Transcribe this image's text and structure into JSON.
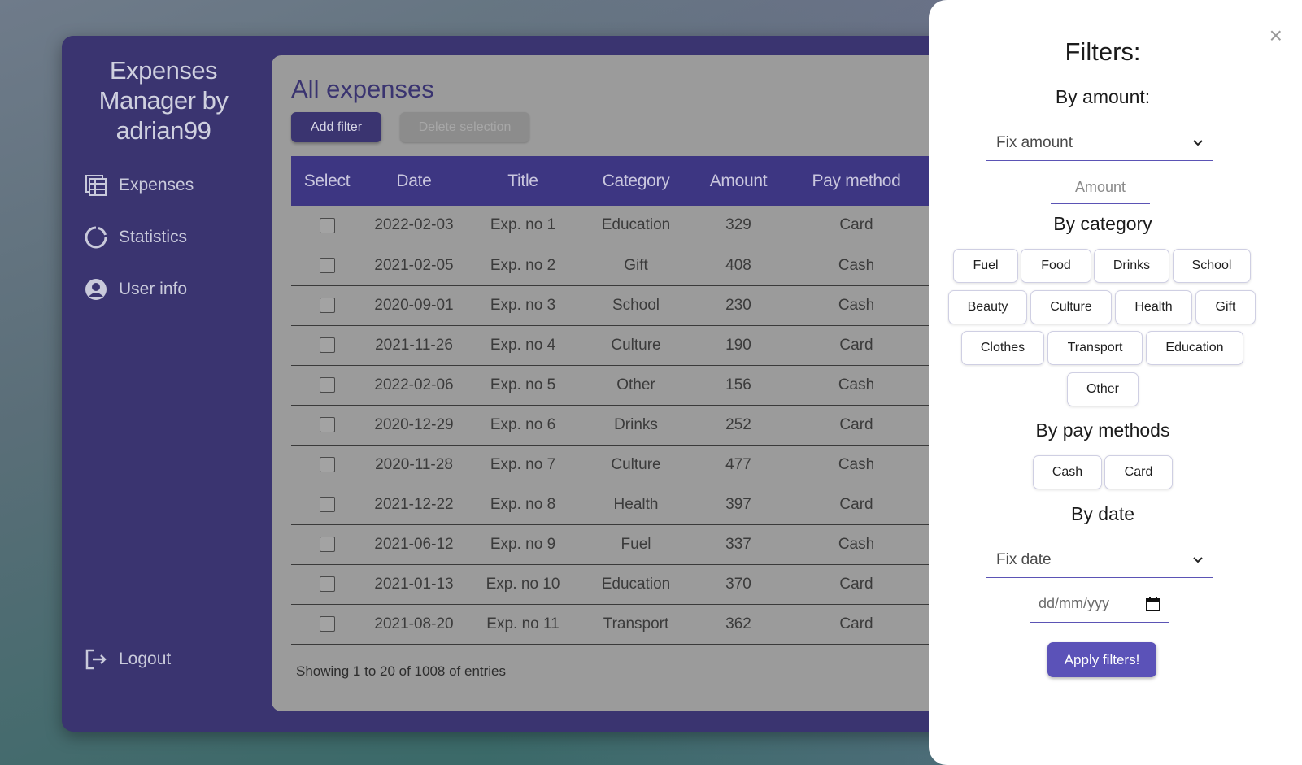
{
  "app": {
    "brand": "Expenses Manager by adrian99",
    "nav": [
      {
        "label": "Expenses",
        "icon": "table-icon"
      },
      {
        "label": "Statistics",
        "icon": "chart-ring-icon"
      },
      {
        "label": "User info",
        "icon": "user-circle-icon"
      }
    ],
    "logout": "Logout"
  },
  "main": {
    "title": "All expenses",
    "add_filter": "Add filter",
    "delete_selection": "Delete selection",
    "columns": [
      "Select",
      "Date",
      "Title",
      "Category",
      "Amount",
      "Pay method"
    ],
    "rows": [
      {
        "date": "2022-02-03",
        "title": "Exp. no 1",
        "category": "Education",
        "amount": "329",
        "pay": "Card"
      },
      {
        "date": "2021-02-05",
        "title": "Exp. no 2",
        "category": "Gift",
        "amount": "408",
        "pay": "Cash"
      },
      {
        "date": "2020-09-01",
        "title": "Exp. no 3",
        "category": "School",
        "amount": "230",
        "pay": "Cash"
      },
      {
        "date": "2021-11-26",
        "title": "Exp. no 4",
        "category": "Culture",
        "amount": "190",
        "pay": "Card"
      },
      {
        "date": "2022-02-06",
        "title": "Exp. no 5",
        "category": "Other",
        "amount": "156",
        "pay": "Cash"
      },
      {
        "date": "2020-12-29",
        "title": "Exp. no 6",
        "category": "Drinks",
        "amount": "252",
        "pay": "Card"
      },
      {
        "date": "2020-11-28",
        "title": "Exp. no 7",
        "category": "Culture",
        "amount": "477",
        "pay": "Cash"
      },
      {
        "date": "2021-12-22",
        "title": "Exp. no 8",
        "category": "Health",
        "amount": "397",
        "pay": "Card"
      },
      {
        "date": "2021-06-12",
        "title": "Exp. no 9",
        "category": "Fuel",
        "amount": "337",
        "pay": "Cash"
      },
      {
        "date": "2021-01-13",
        "title": "Exp. no 10",
        "category": "Education",
        "amount": "370",
        "pay": "Card"
      },
      {
        "date": "2021-08-20",
        "title": "Exp. no 11",
        "category": "Transport",
        "amount": "362",
        "pay": "Card"
      }
    ],
    "footer": "Showing 1 to 20 of 1008 of entries"
  },
  "filters": {
    "title": "Filters:",
    "by_amount": "By amount:",
    "amount_mode": "Fix amount",
    "amount_placeholder": "Amount",
    "by_category": "By category",
    "categories": [
      "Fuel",
      "Food",
      "Drinks",
      "School",
      "Beauty",
      "Culture",
      "Health",
      "Gift",
      "Clothes",
      "Transport",
      "Education",
      "Other"
    ],
    "by_pay": "By pay methods",
    "pay_methods": [
      "Cash",
      "Card"
    ],
    "by_date": "By date",
    "date_mode": "Fix date",
    "date_placeholder": "dd/mm/yyy",
    "apply": "Apply filters!",
    "close": "×"
  }
}
